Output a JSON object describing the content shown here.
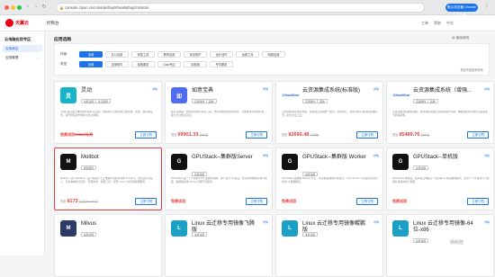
{
  "browser": {
    "url": "console.ctyun.cn/console/hap/#/workshop/cn/store",
    "action_button": "默认浏览器 Chrome 浏览器"
  },
  "header": {
    "logo": "天翼云",
    "console": "控制台",
    "right_items": [
      "工单",
      "帮助",
      "中文"
    ]
  },
  "sidebar": {
    "title": "云电脑应用专区",
    "items": [
      {
        "label": "应用商店",
        "active": true
      },
      {
        "label": "应用管理",
        "active": false
      }
    ]
  },
  "page": {
    "title": "应用选购",
    "top_right": "@ 使用说明",
    "sort_note": "按优先级推荐排序"
  },
  "filters": {
    "row1": {
      "label": "场景",
      "chips": [
        "全部",
        "办公应用",
        "研发工具",
        "教育应用",
        "安全防护",
        "设计创作",
        "运维工具",
        "网络加速"
      ]
    },
    "row2": {
      "label": "类型",
      "chips": [
        "全部",
        "应用软件",
        "增值服务",
        "Claw专区",
        "标准版",
        "专享服务"
      ]
    }
  },
  "cards": [
    {
      "name": "灵动",
      "tags": [
        "免费试用",
        "生活服务"
      ],
      "vendor": "详情",
      "desc": "\"灵动\"是天翼云推出的智能办公应用，帮助用户高效完成日常文档、表格、会议等任务，提升团队协作效率与办公体验。",
      "price_prefix": "免费试用",
      "price": "",
      "orig": "¥1890元/月",
      "button": "立即订购",
      "free": true,
      "icon": "灵",
      "color": "#17b3c9"
    },
    {
      "name": "如意宝典",
      "tags": [
        "应用软件",
        "其他"
      ],
      "vendor": "详情",
      "desc": "如意宝典是一款知识管理与检索工具，支持海量文档智能搜索、分类整理与快速问答，助力企业知识沉淀。",
      "price_prefix": "低至",
      "price": "¥9901.33",
      "orig": "元/年起",
      "button": "立即订购",
      "free": false,
      "icon": "如",
      "color": "#4d6cf2"
    },
    {
      "name": "云资源集成系统(标准版)",
      "tags": [
        "应用软件",
        "其他"
      ],
      "vendor": "详情",
      "desc": "云资源集成系统标准版，提供多云资源统一纳管、资源监控、费用分析与自动化运维能力，助力企业上云。",
      "price_prefix": "低至",
      "price": "¥2696.48",
      "orig": "元/年起",
      "button": "立即订购",
      "free": false,
      "icon": "CloudSun",
      "color": "#1a5fd6"
    },
    {
      "name": "云资源集成系统（增强...",
      "tags": [
        "应用软件",
        "其他"
      ],
      "vendor": "详情",
      "desc": "云资源集成系统增强版，在标准版基础上增加多租户管理、精细化权限控制与高级报表分析等功能。",
      "price_prefix": "低至",
      "price": "¥5489.76",
      "orig": "元/年起",
      "button": "立即订购",
      "free": false,
      "icon": "CloudSun",
      "color": "#1a5fd6"
    },
    {
      "name": "Moltbot",
      "tags": [
        "增值服务"
      ],
      "vendor": "",
      "desc": "Moltbot（原 Clawdbot）是一种运行于云电脑环境的智能体 AI Agent，支持多平台接入，可在本地执行任务、管理文件、调用工具，实现 7x24 小时智能助理服务。",
      "price_prefix": "低至",
      "price": "¥173",
      "orig": "元/月起 ¥276/月",
      "button": "立即订购",
      "free": false,
      "icon": "M",
      "color": "#111111"
    },
    {
      "name": "GPUStack--集群版Server",
      "tags": [
        "免费试用"
      ],
      "vendor": "详情",
      "desc": "GPUStack 是一个开源的 GPU 集群管理器，用于运行 AI 模型，支持多种推理引擎与模型，集群版提供 Server 管理节点服务。",
      "price_prefix": "免费试用",
      "price": "",
      "orig": "",
      "button": "立即订购",
      "free": true,
      "icon": "G",
      "color": "#111111"
    },
    {
      "name": "GPUStack--集群版 Worker",
      "tags": [
        "免费试用"
      ],
      "vendor": "详情",
      "desc": "GPUStack 集群版 Worker 节点，负责模型推理计算任务，可与 Server 节点配合实现分布式 AI 推理服务。",
      "price_prefix": "免费试用",
      "price": "",
      "orig": "",
      "button": "立即订购",
      "free": true,
      "icon": "G",
      "color": "#111111"
    },
    {
      "name": "GPUStack--单机版",
      "tags": [
        "免费试用"
      ],
      "vendor": "详情",
      "desc": "GPUStack 单机版，在单台云电脑上一键部署 AI 模型推理服务，适合个人开发者与小型团队快速体验大模型。",
      "price_prefix": "免费试用",
      "price": "",
      "orig": "",
      "button": "立即订购",
      "free": true,
      "icon": "G",
      "color": "#111111"
    },
    {
      "name": "Milvus",
      "tags": [
        "免费试用"
      ],
      "vendor": "",
      "desc": "",
      "price_prefix": "",
      "price": "",
      "orig": "",
      "button": "",
      "free": true,
      "icon": "M",
      "color": "#2b3a67"
    },
    {
      "name": "Linux 云迁移专用镜像飞腾版",
      "tags": [
        "免费试用"
      ],
      "vendor": "详情",
      "desc": "",
      "price_prefix": "",
      "price": "",
      "orig": "",
      "button": "",
      "free": true,
      "icon": "L",
      "color": "#1aa0c4"
    },
    {
      "name": "Linux 云迁移专用镜像鲲鹏版",
      "tags": [
        "免费试用"
      ],
      "vendor": "详情",
      "desc": "",
      "price_prefix": "",
      "price": "",
      "orig": "",
      "button": "",
      "free": true,
      "icon": "L",
      "color": "#1aa0c4"
    },
    {
      "name": "Linux 云迁移专用镜像-64 位-x86",
      "tags": [
        "免费试用"
      ],
      "vendor": "详情",
      "desc": "",
      "price_prefix": "",
      "price": "",
      "orig": "",
      "button": "",
      "free": true,
      "icon": "L",
      "color": "#1aa0c4"
    }
  ],
  "watermark": "快科技"
}
